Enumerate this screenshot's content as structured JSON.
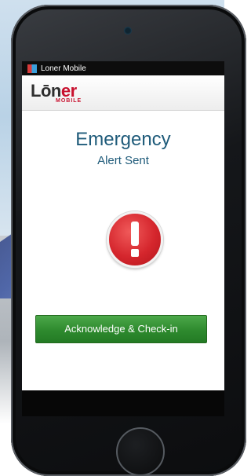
{
  "status_bar": {
    "app_name": "Loner Mobile"
  },
  "header": {
    "logo_main_text_a": "Lōn",
    "logo_main_text_b": "er",
    "logo_sub_text": "MOBILE"
  },
  "alert": {
    "title": "Emergency",
    "subtitle": "Alert Sent",
    "icon": "exclamation-icon"
  },
  "actions": {
    "ack_button_label": "Acknowledge & Check-in"
  },
  "colors": {
    "title_blue": "#1f5b7a",
    "alert_red": "#d5262d",
    "button_green": "#2e8a2e",
    "brand_red": "#c8102e"
  }
}
